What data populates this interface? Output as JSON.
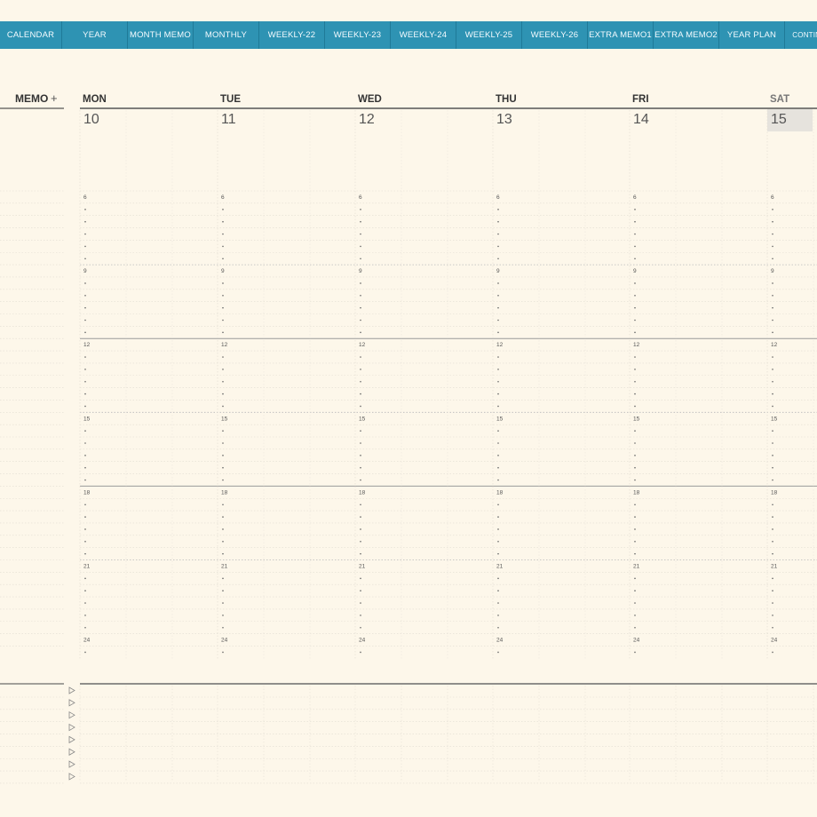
{
  "nav": {
    "tabs": [
      {
        "label": "CALENDAR",
        "width": 69
      },
      {
        "label": "YEAR",
        "width": 73
      },
      {
        "label": "MONTH MEMO",
        "width": 73
      },
      {
        "label": "MONTHLY",
        "width": 73
      },
      {
        "label": "WEEKLY-22",
        "width": 73
      },
      {
        "label": "WEEKLY-23",
        "width": 73
      },
      {
        "label": "WEEKLY-24",
        "width": 73
      },
      {
        "label": "WEEKLY-25",
        "width": 73
      },
      {
        "label": "WEEKLY-26",
        "width": 73
      },
      {
        "label": "EXTRA MEMO1",
        "width": 73
      },
      {
        "label": "EXTRA MEMO2",
        "width": 73
      },
      {
        "label": "YEAR PLAN",
        "width": 73
      },
      {
        "label": "CONTINUE",
        "width": 60
      }
    ]
  },
  "memo": {
    "label": "MEMO",
    "add_symbol": "+"
  },
  "days": [
    {
      "name": "MON",
      "date": "10"
    },
    {
      "name": "TUE",
      "date": "11"
    },
    {
      "name": "WED",
      "date": "12"
    },
    {
      "name": "THU",
      "date": "13"
    },
    {
      "name": "FRI",
      "date": "14"
    },
    {
      "name": "SAT",
      "date": "15",
      "highlight": true
    }
  ],
  "hour_labels": [
    "6",
    "9",
    "12",
    "15",
    "18",
    "21",
    "24"
  ],
  "colors": {
    "nav_bar": "#2e93b3",
    "background": "#fdf7ea",
    "highlight_cell": "#e6e3dd",
    "rule": "#6b6b6b"
  },
  "icons": {
    "task_marker": "triangle-right-icon"
  }
}
